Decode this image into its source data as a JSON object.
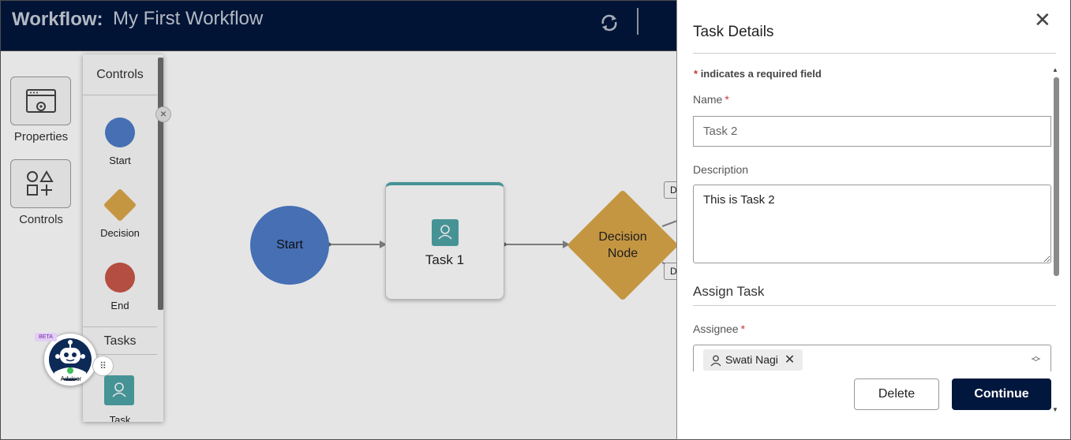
{
  "header": {
    "label": "Workflow:",
    "name": "My First Workflow"
  },
  "sidebar": {
    "properties_label": "Properties",
    "controls_label": "Controls"
  },
  "controls_palette": {
    "title": "Controls",
    "items": [
      {
        "label": "Start",
        "color": "#4f7cc9"
      },
      {
        "label": "Decision",
        "color": "#dca84a"
      },
      {
        "label": "End",
        "color": "#c9564a"
      }
    ],
    "tasks_title": "Tasks",
    "task_item_label": "Task"
  },
  "canvas": {
    "start_label": "Start",
    "task_label": "Task 1",
    "decision_label_line1": "Decision",
    "decision_label_line2": "Node",
    "edge_tag_top": "D",
    "edge_tag_bottom": "D"
  },
  "advisor": {
    "badge": "BETA",
    "label": "Advisor"
  },
  "panel": {
    "title": "Task Details",
    "required_note_star": "*",
    "required_note": "indicates a required field",
    "name_label": "Name",
    "name_value": "Task 2",
    "description_label": "Description",
    "description_value": "This is Task 2",
    "assign_title": "Assign Task",
    "assignee_label": "Assignee",
    "assignee_chip": "Swati Nagi",
    "delete_label": "Delete",
    "continue_label": "Continue",
    "required_star": "*"
  },
  "colors": {
    "header_bg": "#02173d",
    "primary_button": "#02173d",
    "required_star": "#c23934",
    "task_teal": "#4fa4a8"
  }
}
